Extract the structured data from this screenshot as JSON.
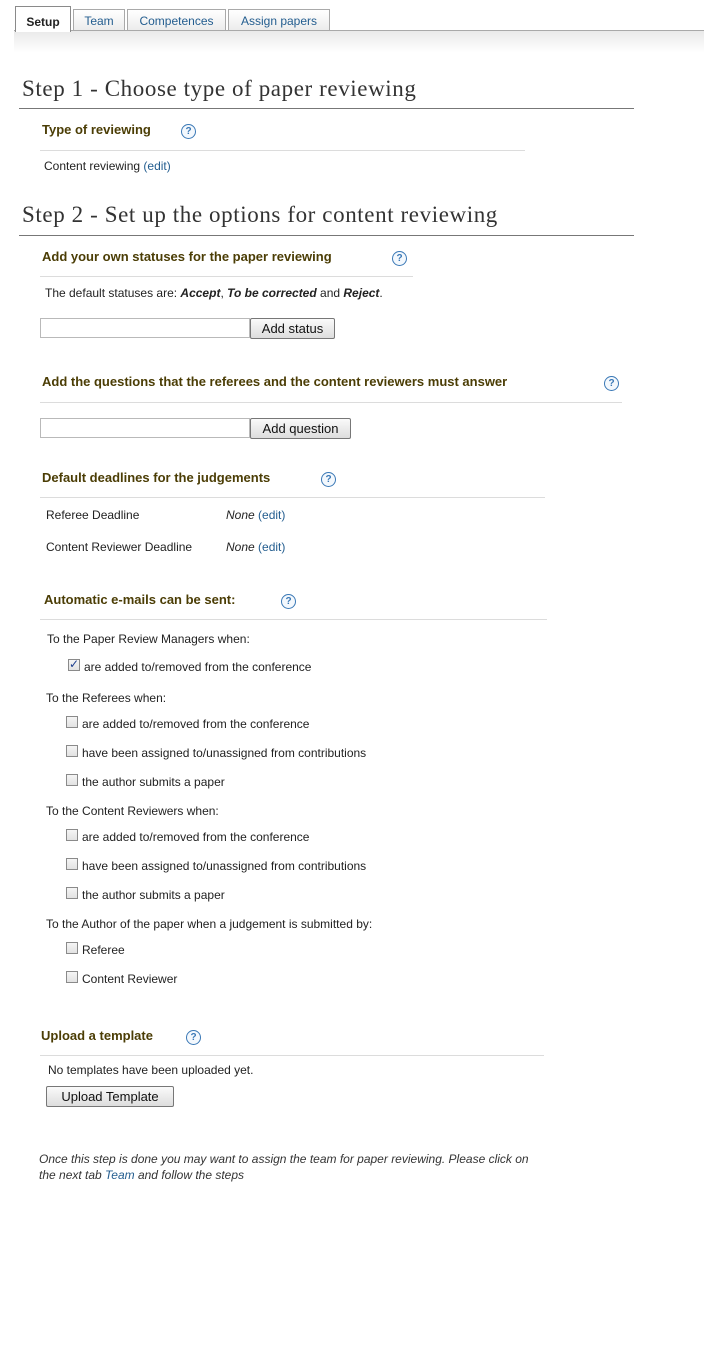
{
  "tabs": [
    {
      "label": "Setup",
      "active": true
    },
    {
      "label": "Team",
      "active": false
    },
    {
      "label": "Competences",
      "active": false
    },
    {
      "label": "Assign papers",
      "active": false
    }
  ],
  "step1": {
    "title": "Step 1 - Choose type of paper reviewing",
    "type_section": {
      "title": "Type of reviewing",
      "value": "Content reviewing",
      "edit_label": "(edit)"
    }
  },
  "step2": {
    "title": "Step 2 - Set up the options for content reviewing",
    "statuses": {
      "title": "Add your own statuses for the paper reviewing",
      "intro": "The default statuses are: ",
      "status_1": "Accept",
      "sep_1": ", ",
      "status_2": "To be corrected",
      "sep_2": " and ",
      "status_3": "Reject",
      "end": ".",
      "input_value": "",
      "button_label": "Add status"
    },
    "questions": {
      "title": "Add the questions that the referees and the content reviewers must answer",
      "input_value": "",
      "button_label": "Add question"
    },
    "deadlines": {
      "title": "Default deadlines for the judgements",
      "rows": [
        {
          "label": "Referee Deadline",
          "value": "None",
          "edit_label": "(edit)"
        },
        {
          "label": "Content Reviewer Deadline",
          "value": "None",
          "edit_label": "(edit)"
        }
      ]
    },
    "emails": {
      "title": "Automatic e-mails can be sent:",
      "groups": [
        {
          "label": "To the Paper Review Managers when:",
          "options": [
            {
              "label": "are added to/removed from the conference",
              "checked": true
            }
          ]
        },
        {
          "label": "To the Referees when:",
          "options": [
            {
              "label": "are added to/removed from the conference",
              "checked": false
            },
            {
              "label": "have been assigned to/unassigned from contributions",
              "checked": false
            },
            {
              "label": "the author submits a paper",
              "checked": false
            }
          ]
        },
        {
          "label": "To the Content Reviewers when:",
          "options": [
            {
              "label": "are added to/removed from the conference",
              "checked": false
            },
            {
              "label": "have been assigned to/unassigned from contributions",
              "checked": false
            },
            {
              "label": "the author submits a paper",
              "checked": false
            }
          ]
        },
        {
          "label": "To the Author of the paper when a judgement is submitted by:",
          "options": [
            {
              "label": "Referee",
              "checked": false
            },
            {
              "label": "Content Reviewer",
              "checked": false
            }
          ]
        }
      ]
    },
    "template": {
      "title": "Upload a template",
      "empty_text": "No templates have been uploaded yet.",
      "button_label": "Upload Template"
    }
  },
  "footnote": {
    "text_before": "Once this step is done you may want to assign the team for paper reviewing. Please click on the next tab ",
    "link_label": "Team",
    "text_after": " and follow the steps"
  },
  "help_glyph": "?"
}
